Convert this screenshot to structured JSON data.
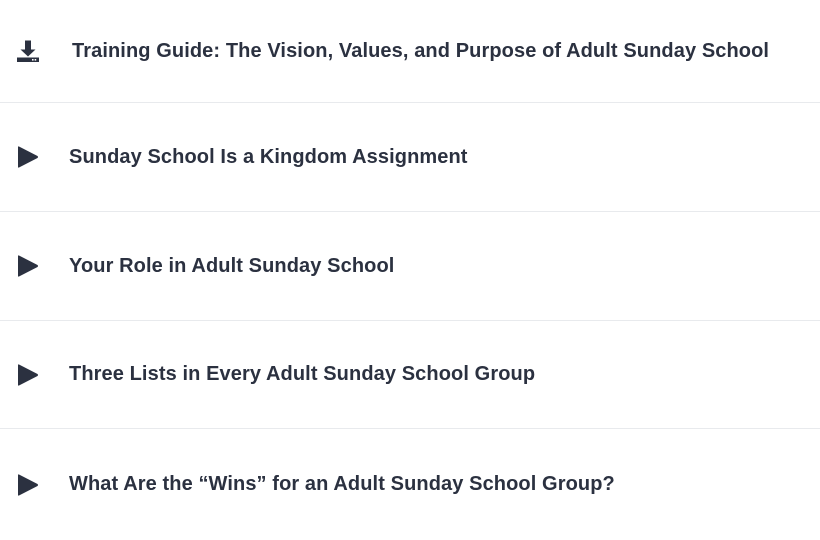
{
  "lessons": [
    {
      "icon": "download-icon",
      "title": "Training Guide: The Vision, Values, and Purpose of Adult Sunday School"
    },
    {
      "icon": "play-icon",
      "title": "Sunday School Is a Kingdom Assignment"
    },
    {
      "icon": "play-icon",
      "title": "Your Role in Adult Sunday School"
    },
    {
      "icon": "play-icon",
      "title": "Three Lists in Every Adult Sunday School Group"
    },
    {
      "icon": "play-icon",
      "title": "What Are the “Wins” for an Adult Sunday School Group?"
    }
  ],
  "colors": {
    "text": "#2b3140",
    "icon": "#2b3140",
    "divider": "#e8eaed",
    "background": "#ffffff"
  }
}
